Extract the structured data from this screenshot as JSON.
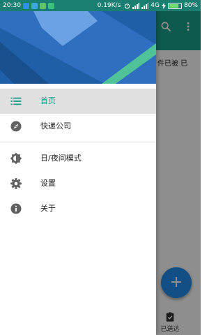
{
  "status_bar": {
    "time": "20:30",
    "speed": "0.19K/s",
    "network": "4G",
    "battery": "80%",
    "battery_level": 0.8,
    "notification_colors": [
      "#2f8fe6",
      "#3ba7e0",
      "#5fc36a",
      "#3cc27a"
    ]
  },
  "drawer": {
    "header_colors": {
      "base": "#1f5fa8",
      "light": "#6aa2e4",
      "mid": "#2f6fc0",
      "accent": "#4fc397"
    },
    "menu": [
      {
        "label": "首页",
        "icon": "list-icon",
        "active": true
      },
      {
        "label": "快递公司",
        "icon": "compass-icon",
        "active": false
      },
      {
        "label": "日/夜间模式",
        "icon": "brightness-icon",
        "active": false
      },
      {
        "label": "设置",
        "icon": "gear-icon",
        "active": false
      },
      {
        "label": "关于",
        "icon": "info-icon",
        "active": false
      }
    ]
  },
  "background_app": {
    "toolbar_color": "#1b9b88",
    "partial_text": "件已被 已",
    "fab_label": "+",
    "bottom_nav_label": "已送达"
  },
  "colors": {
    "accent": "#1b9b88",
    "icon_gray": "#616161",
    "fab": "#1e88e5"
  }
}
